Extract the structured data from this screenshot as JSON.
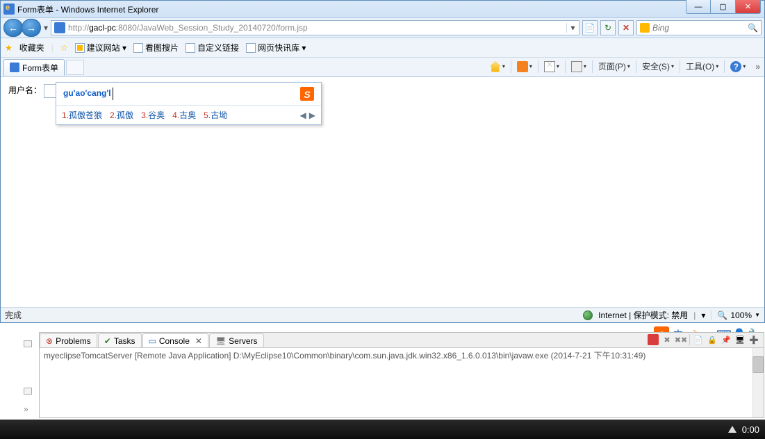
{
  "window": {
    "title": "Form表单 - Windows Internet Explorer"
  },
  "nav": {
    "url_prefix": "http://",
    "url_host": "gacl-pc",
    "url_rest": ":8080/JavaWeb_Session_Study_20140720/form.jsp",
    "search_engine": "Bing"
  },
  "favbar": {
    "label": "收藏夹",
    "items": [
      "建议网站 ▾",
      "看图搜片",
      "自定义链接",
      "网页快讯库 ▾"
    ]
  },
  "tabs": {
    "active": "Form表单"
  },
  "cmdbar": {
    "page": "页面(P)",
    "safety": "安全(S)",
    "tools": "工具(O)"
  },
  "form": {
    "label": "用户名："
  },
  "ime": {
    "composition": "gu'ao'cang'l",
    "candidates": [
      {
        "n": "1.",
        "w": "孤傲苍狼"
      },
      {
        "n": "2.",
        "w": "孤傲"
      },
      {
        "n": "3.",
        "w": "谷奥"
      },
      {
        "n": "4.",
        "w": "古奥"
      },
      {
        "n": "5.",
        "w": "古坳"
      }
    ]
  },
  "status": {
    "done": "完成",
    "zone": "Internet | 保护模式: 禁用",
    "zoom": "100%"
  },
  "eclipse": {
    "tabs": [
      "Problems",
      "Tasks",
      "Console",
      "Servers"
    ],
    "active": "Console",
    "line": "myeclipseTomcatServer [Remote Java Application] D:\\MyEclipse10\\Common\\binary\\com.sun.java.jdk.win32.x86_1.6.0.013\\bin\\javaw.exe (2014-7-21 下午10:31:49)"
  },
  "taskbar": {
    "time": "0:00"
  }
}
